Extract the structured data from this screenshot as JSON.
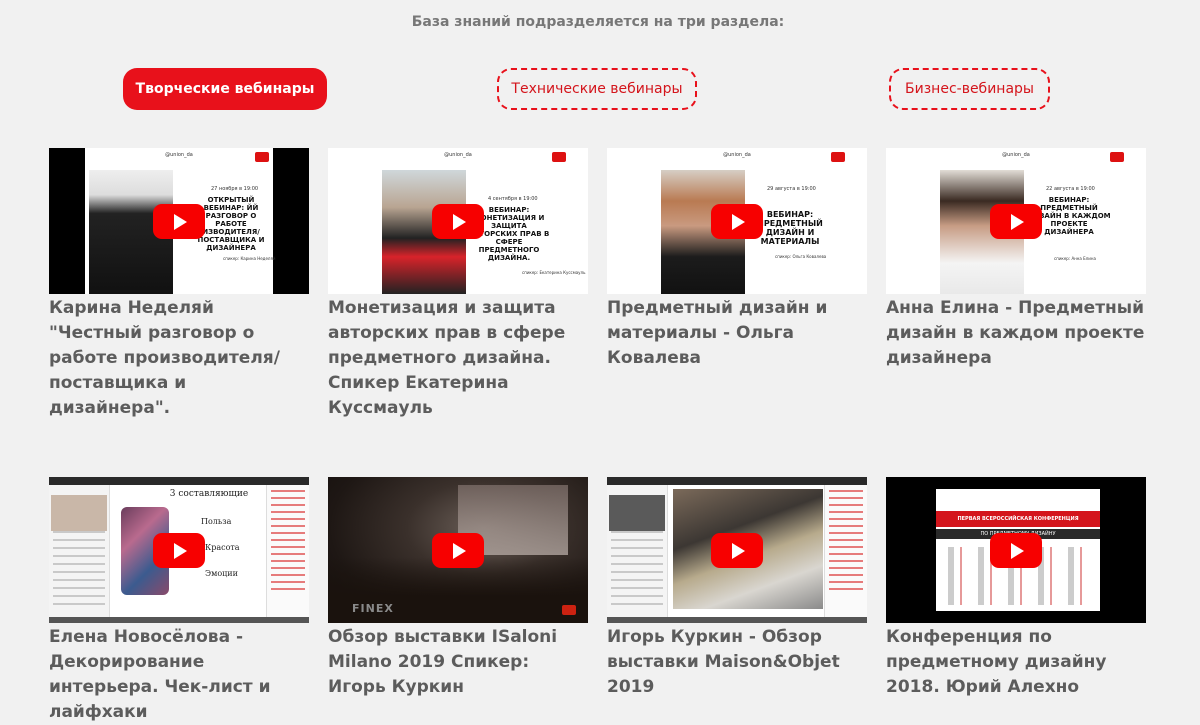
{
  "intro": "База знаний подразделяется на три раздела:",
  "tabs": [
    {
      "label": "Творческие вебинары",
      "active": true
    },
    {
      "label": "Технические вебинары",
      "active": false
    },
    {
      "label": "Бизнес-вебинары",
      "active": false
    }
  ],
  "colors": {
    "accent": "#e8111b",
    "title": "#5c5c5c",
    "background": "#f1f1f1",
    "play": "#f70000"
  },
  "videos": [
    {
      "title": "Карина Неделяй \"Честный разговор о работе производителя/ поставщика и дизайнера\".",
      "thumb": {
        "brand": "@union_da",
        "date": "27 ноября в 19:00",
        "heading": "ОТКРЫТЫЙ ВЕБИНАР: ЙЙ РАЗГОВОР О РАБОТЕ ИЗВОДИТЕЛЯ/ ПОСТАВЩИКА И ДИЗАЙНЕРА",
        "speaker": "спикер: Карина Неделяй"
      }
    },
    {
      "title": "Монетизация и защита авторских прав в сфере предметного дизайна. Спикер Екатерина Куссмауль",
      "thumb": {
        "brand": "@union_da",
        "date": "4 сентября в 19:00",
        "heading": "ВЕБИНАР: МОНЕТИЗАЦИЯ И ЗАЩИТА АВТОРСКИХ ПРАВ В СФЕРЕ ПРЕДМЕТНОГО ДИЗАЙНА.",
        "speaker": "спикер: Екатерина Куссмауль"
      }
    },
    {
      "title": "Предметный дизайн и материалы - Ольга Ковалева",
      "thumb": {
        "brand": "@union_da",
        "date": "29 августа в 19:00",
        "heading": "ВЕБИНАР: ПРЕДМЕТНЫЙ ДИЗАЙН И МАТЕРИАЛЫ",
        "speaker": "спикер: Ольга Ковалева"
      }
    },
    {
      "title": "Анна Елина - Предметный дизайн в каждом проекте дизайнера",
      "thumb": {
        "brand": "@union_da",
        "date": "22 августа в 19:00",
        "heading": "ВЕБИНАР: ПРЕДМЕТНЫЙ ДИЗАЙН В КАЖДОМ ПРОЕКТЕ ДИЗАЙНЕРА",
        "speaker": "спикер: Анна Елина"
      }
    },
    {
      "title": "Елена Новосёлова - Декорирование интерьера. Чек-лист и лайфхаки",
      "thumb": {
        "slide_title": "3 составляющие",
        "bullets": [
          "Польза",
          "Красота",
          "Эмоции"
        ]
      }
    },
    {
      "title": "Обзор выставки ISaloni Milano 2019 Спикер: Игорь Куркин",
      "thumb": {
        "watermark": "FINEX"
      }
    },
    {
      "title": "Игорь Куркин - Обзор выставки Maison&Objet 2019",
      "thumb": {}
    },
    {
      "title": "Конференция по предметному дизайну 2018. Юрий Алехно",
      "thumb": {
        "banner": "ПЕРВАЯ ВСЕРОССИЙСКАЯ КОНФЕРЕНЦИЯ",
        "subbanner": "ПО ПРЕДМЕТНОМУ ДИЗАЙНУ"
      }
    }
  ]
}
